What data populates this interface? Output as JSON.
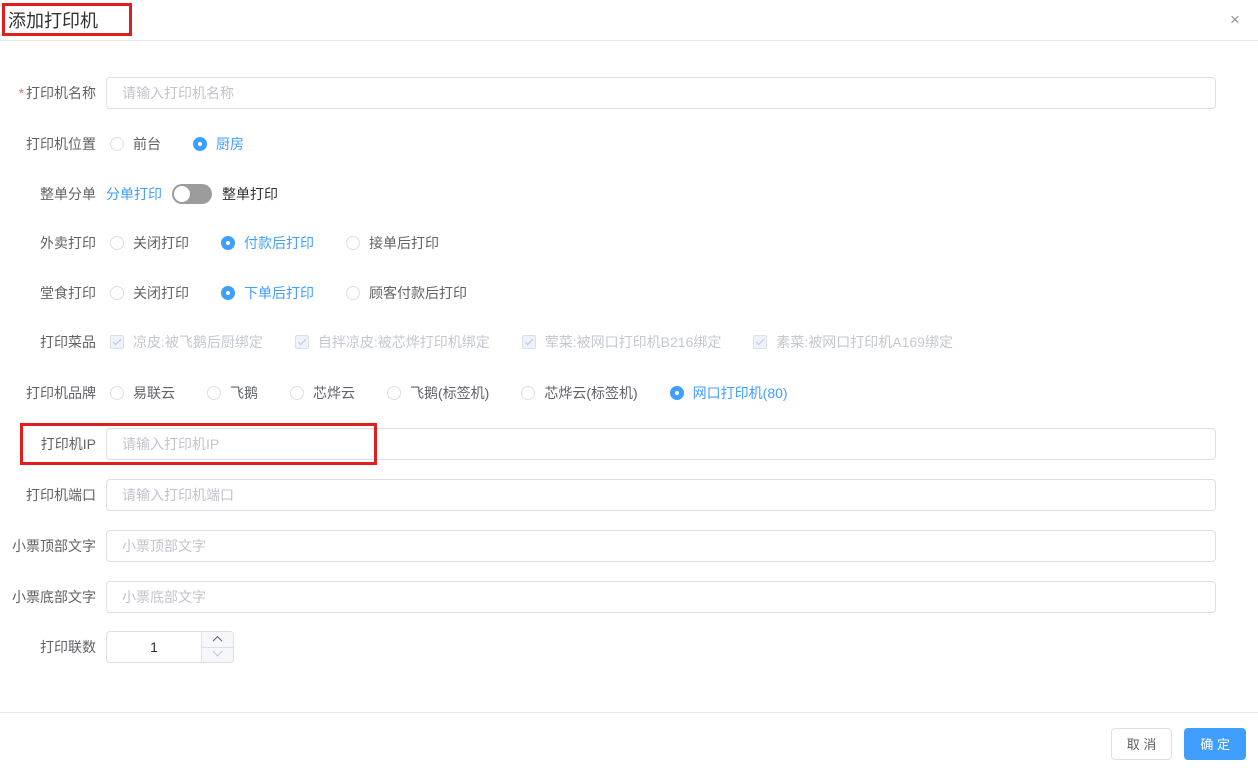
{
  "dialog": {
    "title": "添加打印机",
    "close_icon": "×"
  },
  "form": {
    "printer_name": {
      "label": "打印机名称",
      "required_mark": "*",
      "placeholder": "请输入打印机名称",
      "value": ""
    },
    "printer_location": {
      "label": "打印机位置",
      "options": [
        {
          "label": "前台",
          "selected": false
        },
        {
          "label": "厨房",
          "selected": true
        }
      ]
    },
    "order_split": {
      "label": "整单分单",
      "left_label": "分单打印",
      "right_label": "整单打印",
      "switch_on": false
    },
    "takeout_print": {
      "label": "外卖打印",
      "options": [
        {
          "label": "关闭打印",
          "selected": false
        },
        {
          "label": "付款后打印",
          "selected": true
        },
        {
          "label": "接单后打印",
          "selected": false
        }
      ]
    },
    "dinein_print": {
      "label": "堂食打印",
      "options": [
        {
          "label": "关闭打印",
          "selected": false
        },
        {
          "label": "下单后打印",
          "selected": true
        },
        {
          "label": "顾客付款后打印",
          "selected": false
        }
      ]
    },
    "print_dishes": {
      "label": "打印菜品",
      "options": [
        {
          "label": "凉皮:被飞鹅后厨绑定",
          "checked": true,
          "disabled": true
        },
        {
          "label": "自拌凉皮:被芯烨打印机绑定",
          "checked": true,
          "disabled": true
        },
        {
          "label": "荤菜:被网口打印机B216绑定",
          "checked": true,
          "disabled": true
        },
        {
          "label": "素菜:被网口打印机A169绑定",
          "checked": true,
          "disabled": true
        }
      ]
    },
    "printer_brand": {
      "label": "打印机品牌",
      "options": [
        {
          "label": "易联云",
          "selected": false
        },
        {
          "label": "飞鹅",
          "selected": false
        },
        {
          "label": "芯烨云",
          "selected": false
        },
        {
          "label": "飞鹅(标签机)",
          "selected": false
        },
        {
          "label": "芯烨云(标签机)",
          "selected": false
        },
        {
          "label": "网口打印机(80)",
          "selected": true
        }
      ]
    },
    "printer_ip": {
      "label": "打印机IP",
      "placeholder": "请输入打印机IP",
      "value": ""
    },
    "printer_port": {
      "label": "打印机端口",
      "placeholder": "请输入打印机端口",
      "value": ""
    },
    "receipt_header": {
      "label": "小票顶部文字",
      "placeholder": "小票顶部文字",
      "value": ""
    },
    "receipt_footer": {
      "label": "小票底部文字",
      "placeholder": "小票底部文字",
      "value": ""
    },
    "print_copies": {
      "label": "打印联数",
      "value": "1"
    }
  },
  "footer": {
    "cancel_label": "取 消",
    "confirm_label": "确 定"
  },
  "colors": {
    "primary_blue": "#409EFF",
    "annotation_red": "#E01E1E",
    "switch_off_gray": "#9C9C9C"
  }
}
